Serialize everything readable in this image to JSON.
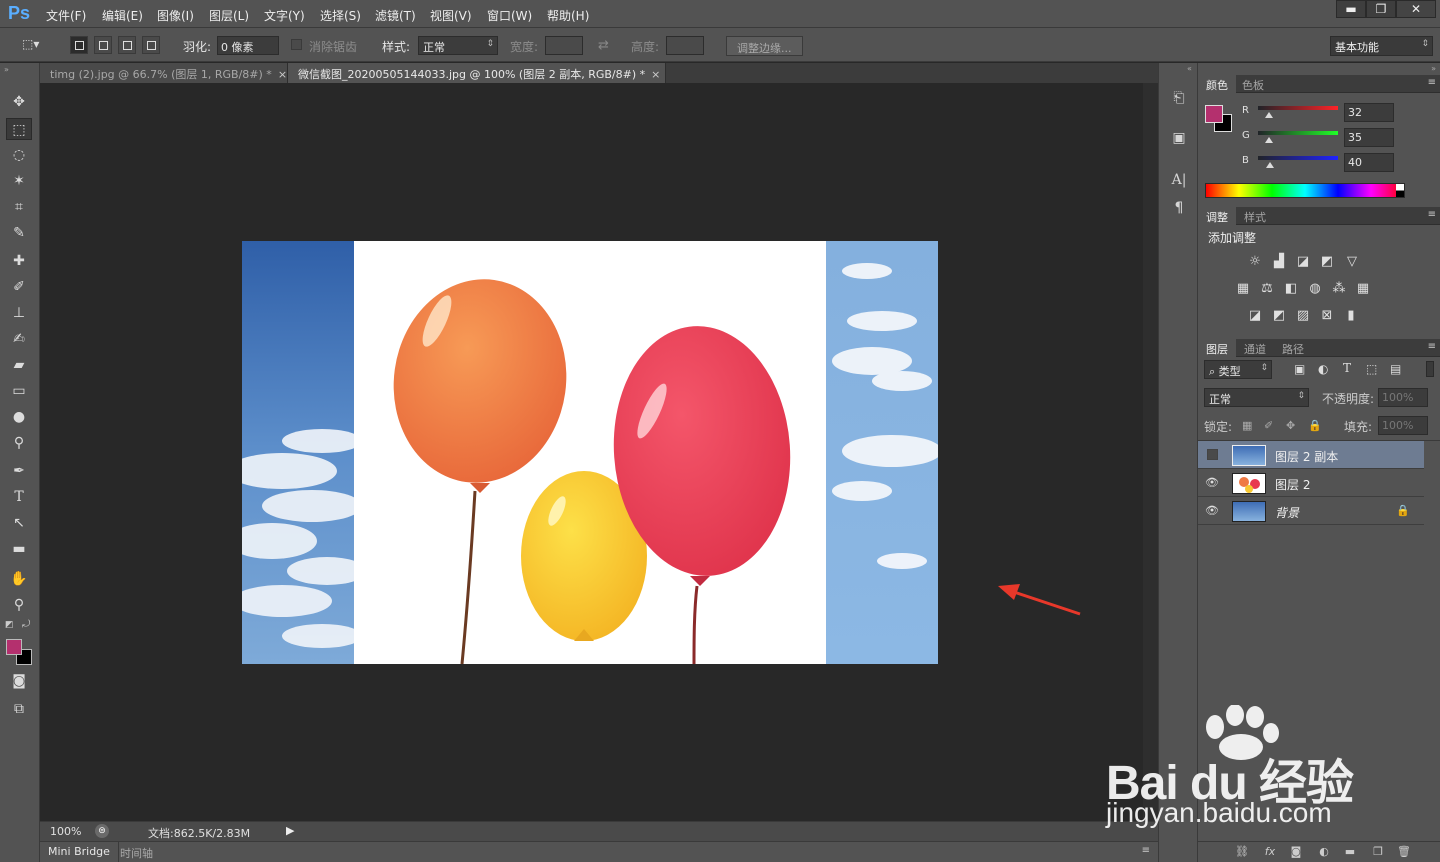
{
  "app": {
    "logo": "Ps"
  },
  "menu": [
    "文件(F)",
    "编辑(E)",
    "图像(I)",
    "图层(L)",
    "文字(Y)",
    "选择(S)",
    "滤镜(T)",
    "视图(V)",
    "窗口(W)",
    "帮助(H)"
  ],
  "window_controls": {
    "minimize": "▬",
    "restore": "❐",
    "close": "✕"
  },
  "options": {
    "feather_label": "羽化:",
    "feather_value": "0 像素",
    "antialias_label": "消除锯齿",
    "style_label": "样式:",
    "style_value": "正常",
    "width_label": "宽度:",
    "height_label": "高度:",
    "refine_edge_button": "调整边缘...",
    "workspace_value": "基本功能"
  },
  "tabs": [
    {
      "label": "timg (2).jpg @ 66.7% (图层 1, RGB/8#) *",
      "close": "×"
    },
    {
      "label": "微信截图_20200505144033.jpg @ 100% (图层 2 副本, RGB/8#) *",
      "close": "×"
    }
  ],
  "status": {
    "zoom": "100%",
    "doc_info": "文档:862.5K/2.83M"
  },
  "bottom_tabs": {
    "mini_bridge": "Mini Bridge",
    "timeline": "时间轴"
  },
  "colors": {
    "foreground": "#b4306e",
    "background": "#000000",
    "accent_blue": "#5aaeff",
    "arrow": "#e8382a"
  },
  "color_panel": {
    "tabs": [
      "颜色",
      "色板"
    ],
    "r_label": "R",
    "g_label": "G",
    "b_label": "B",
    "r": "32",
    "g": "35",
    "b": "40"
  },
  "adjust_panel": {
    "tabs": [
      "调整",
      "样式"
    ],
    "heading": "添加调整",
    "icons": [
      "brightness-icon",
      "levels-icon",
      "curves-icon",
      "exposure-icon",
      "vibrance-icon",
      "hue-saturation-icon",
      "color-balance-icon",
      "black-white-icon",
      "photo-filter-icon",
      "channel-mixer-icon",
      "color-lookup-icon",
      "invert-icon",
      "posterize-icon",
      "threshold-icon",
      "gradient-map-icon",
      "selective-color-icon"
    ]
  },
  "layers_panel": {
    "tabs": [
      "图层",
      "通道",
      "路径"
    ],
    "filter_value": "类型",
    "blend_mode": "正常",
    "opacity_label": "不透明度:",
    "opacity_value": "100%",
    "lock_label": "锁定:",
    "fill_label": "填充:",
    "fill_value": "100%",
    "layers": [
      {
        "name": "图层 2 副本",
        "visible": false,
        "selected": true
      },
      {
        "name": "图层 2",
        "visible": true,
        "selected": false
      },
      {
        "name": "背景",
        "visible": true,
        "selected": false,
        "locked": true
      }
    ]
  },
  "watermark": {
    "brand": "Bai du 经验",
    "url": "jingyan.baidu.com"
  }
}
